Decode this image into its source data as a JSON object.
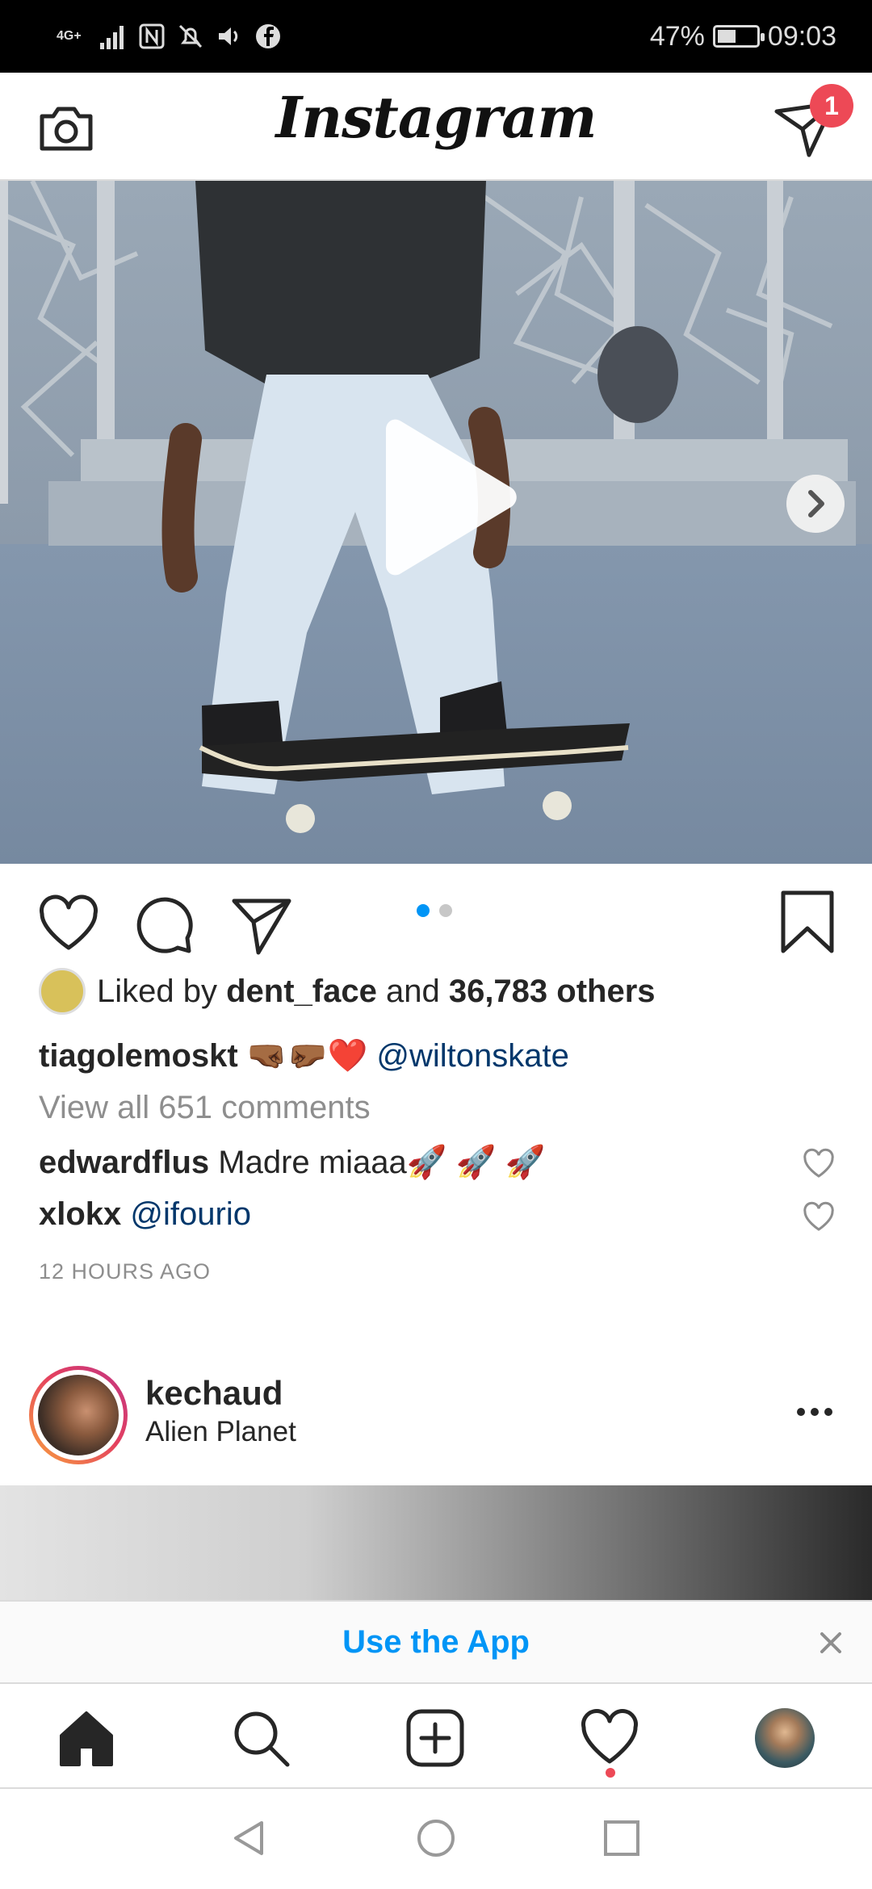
{
  "status_bar": {
    "network": "4G+",
    "battery": "47%",
    "battery_level": 0.47,
    "time": "09:03"
  },
  "header": {
    "logo": "Instagram",
    "dm_badge": "1"
  },
  "post": {
    "carousel_dots": 2,
    "carousel_active": 1,
    "liked_by_prefix": "Liked by ",
    "liked_by_user": "dent_face",
    "liked_by_and": " and ",
    "liked_by_count": "36,783 others",
    "caption_user": "tiagolemoskt",
    "caption_emoji": " 🤜🏾🤛🏾❤️ ",
    "caption_mention": "@wiltonskate",
    "view_comments": "View all 651 comments",
    "comments": [
      {
        "user": "edwardflus",
        "text": " Madre miaaa🚀 🚀 🚀",
        "mention": ""
      },
      {
        "user": "xlokx",
        "text": " ",
        "mention": "@ifourio"
      }
    ],
    "timestamp": "12 HOURS AGO"
  },
  "post2": {
    "user": "kechaud",
    "location": "Alien Planet"
  },
  "banner": {
    "cta": "Use the App"
  },
  "icons": {
    "camera": "camera-icon",
    "direct": "direct-message-icon",
    "play": "play-icon",
    "next": "chevron-right-icon",
    "like": "heart-icon",
    "comment": "comment-icon",
    "share": "share-icon",
    "save": "bookmark-icon",
    "more": "more-icon",
    "close": "close-icon",
    "home": "home-icon",
    "search": "search-icon",
    "new_post": "plus-square-icon",
    "activity": "heart-icon",
    "profile": "avatar",
    "nav_back": "triangle-back-icon",
    "nav_home": "circle-home-icon",
    "nav_recent": "square-recent-icon"
  }
}
